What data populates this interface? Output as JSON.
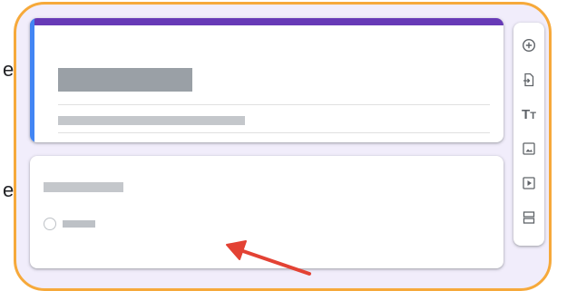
{
  "side_labels": [
    "e",
    "e"
  ],
  "form": {
    "accent_color": "#673ab7",
    "section_edge_color": "#4285f4"
  },
  "toolbar": {
    "items": [
      {
        "icon": "add-question-icon"
      },
      {
        "icon": "import-questions-icon"
      },
      {
        "icon": "add-title-description-icon",
        "label_big": "T",
        "label_small": "T"
      },
      {
        "icon": "add-image-icon"
      },
      {
        "icon": "add-video-icon"
      },
      {
        "icon": "add-section-icon"
      }
    ]
  },
  "colors": {
    "frame_border": "#f6a93b",
    "frame_background": "#f1edfb",
    "arrow": "#e34234"
  }
}
